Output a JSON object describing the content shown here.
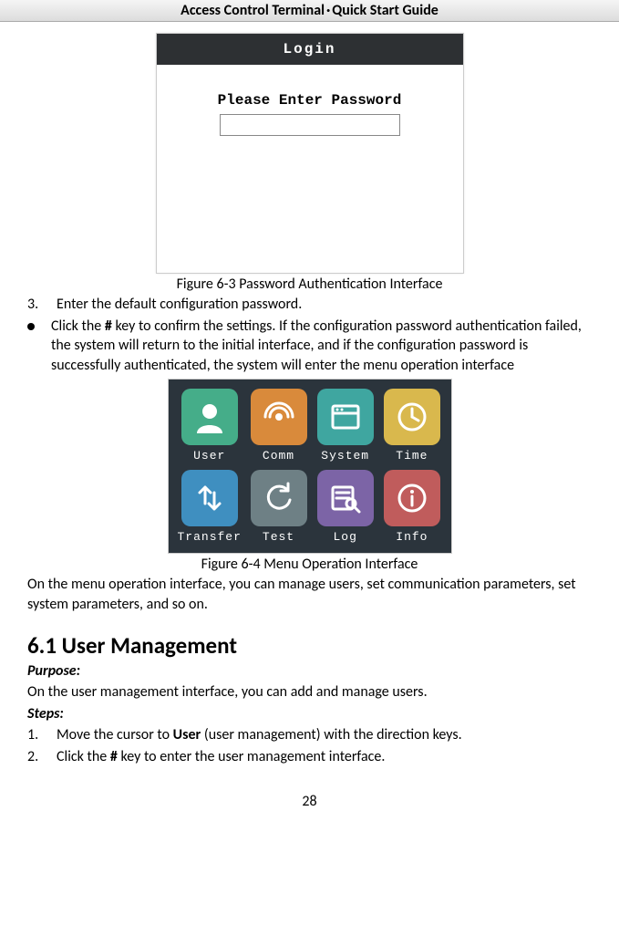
{
  "header": {
    "title_bold": "Access Control Terminal",
    "separator": "·",
    "title_rest": "Quick Start Guide"
  },
  "login_panel": {
    "title": "Login",
    "prompt": "Please Enter Password"
  },
  "figure_6_3": "Figure 6-3 Password Authentication Interface",
  "step3": {
    "num": "3.",
    "text": "Enter the default configuration password."
  },
  "bullet1": {
    "pre": "Click the ",
    "key": "#",
    "post": " key to confirm the settings. If the configuration password authentication failed, the system will return to the initial interface, and if the configuration password is successfully authenticated, the system will enter the menu operation interface"
  },
  "menu": {
    "items": [
      {
        "label": "User",
        "icon": "user-icon",
        "color": "bg-green"
      },
      {
        "label": "Comm",
        "icon": "wifi-icon",
        "color": "bg-orange"
      },
      {
        "label": "System",
        "icon": "window-icon",
        "color": "bg-teal"
      },
      {
        "label": "Time",
        "icon": "clock-icon",
        "color": "bg-yellow"
      },
      {
        "label": "Transfer",
        "icon": "transfer-icon",
        "color": "bg-blue"
      },
      {
        "label": "Test",
        "icon": "refresh-icon",
        "color": "bg-gray"
      },
      {
        "label": "Log",
        "icon": "search-icon",
        "color": "bg-purple"
      },
      {
        "label": "Info",
        "icon": "info-icon",
        "color": "bg-red"
      }
    ]
  },
  "figure_6_4": "Figure 6-4 Menu Operation Interface",
  "para_after_fig4": "On the menu operation interface, you can manage users, set communication parameters, set system parameters, and so on.",
  "section_6_1": "6.1 User Management",
  "purpose_label": "Purpose:",
  "purpose_text": "On the user management interface, you can add and manage users.",
  "steps_label": "Steps:",
  "step_um_1": {
    "num": "1.",
    "pre": "Move the cursor to ",
    "bold": "User",
    "post": " (user management) with the direction keys."
  },
  "step_um_2": {
    "num": "2.",
    "pre": "Click the ",
    "bold": "#",
    "post": " key to enter the user management interface."
  },
  "page_number": "28"
}
